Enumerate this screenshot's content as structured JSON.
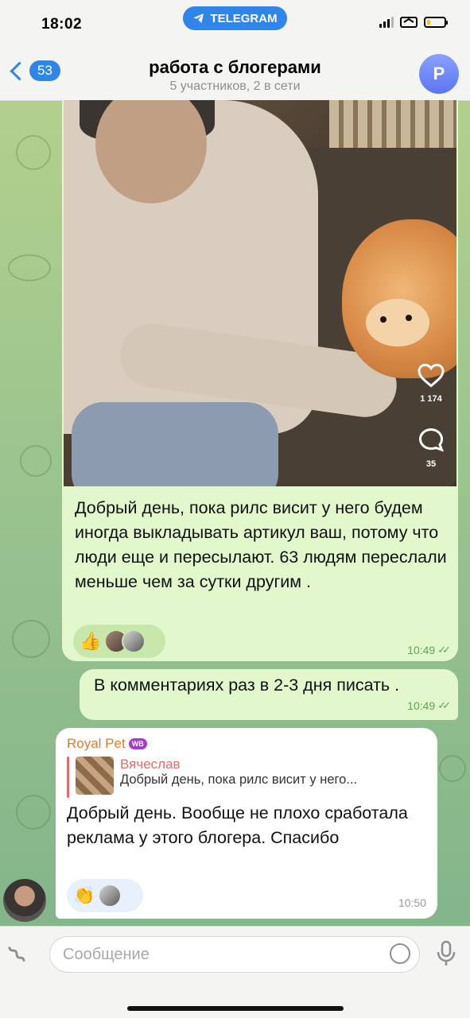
{
  "status": {
    "time": "18:02",
    "app_pill": "TELEGRAM"
  },
  "header": {
    "back_count": "53",
    "title": "работа с блогерами",
    "subtitle": "5 участников, 2 в сети",
    "avatar_letter": "P"
  },
  "reel": {
    "likes": "1 174",
    "comments": "35"
  },
  "messages": [
    {
      "text": "Добрый день, пока рилс висит у него будем иногда выкладывать артикул ваш, потому что люди еще и пересылают. 63 людям переслали меньше чем за сутки другим .",
      "reaction_emoji": "👍",
      "time": "10:49"
    },
    {
      "text": "В комментариях раз в 2-3 дня писать .",
      "time": "10:49"
    },
    {
      "sender": "Royal Pet",
      "sender_badge": "WB",
      "reply_name": "Вячеслав",
      "reply_text": "Добрый день, пока рилс висит у него...",
      "text": "Добрый день. Вообще не плохо сработала реклама у этого блогера. Спасибо",
      "reaction_emoji": "👏",
      "time": "10:50"
    }
  ],
  "composer": {
    "placeholder": "Сообщение"
  },
  "colors": {
    "accent": "#2f86e8",
    "outgoing_bubble": "#e2f7cb",
    "sender_name": "#e07a2e"
  }
}
